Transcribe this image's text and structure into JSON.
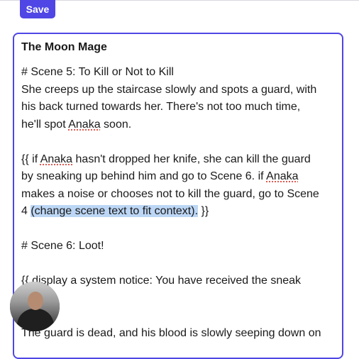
{
  "toolbar": {
    "save_label": "Save"
  },
  "document": {
    "title": "The Moon Mage",
    "lines": {
      "l1": "# Scene 5: To Kill or Not to Kill",
      "l2": "She creeps up the staircase slowly and spots a guard, with",
      "l3": "his back turned towards her. There's not too much time,",
      "l4a": "he'll spot ",
      "l4b": "Anaka",
      "l4c": " soon.",
      "l5a": "{{ if ",
      "l5b": "Anaka",
      "l5c": " hasn't dropped her knife, she can kill the guard",
      "l6a": "by sneaking up behind him and go to Scene 6. if ",
      "l6b": "Anaka",
      "l7": "makes a noise or chooses not to kill the guard, go to Scene",
      "l8a": "4 ",
      "l8b": "(change scene text to fit context).",
      "l8c": " }}",
      "l9": "# Scene 6: Loot!",
      "l10": "{{ display a system notice: You have received the sneak",
      "l11": "The guard is dead, and his blood is slowly seeping down on"
    }
  },
  "colors": {
    "accent": "#4f46e5",
    "selection": "#bcd6f5"
  }
}
